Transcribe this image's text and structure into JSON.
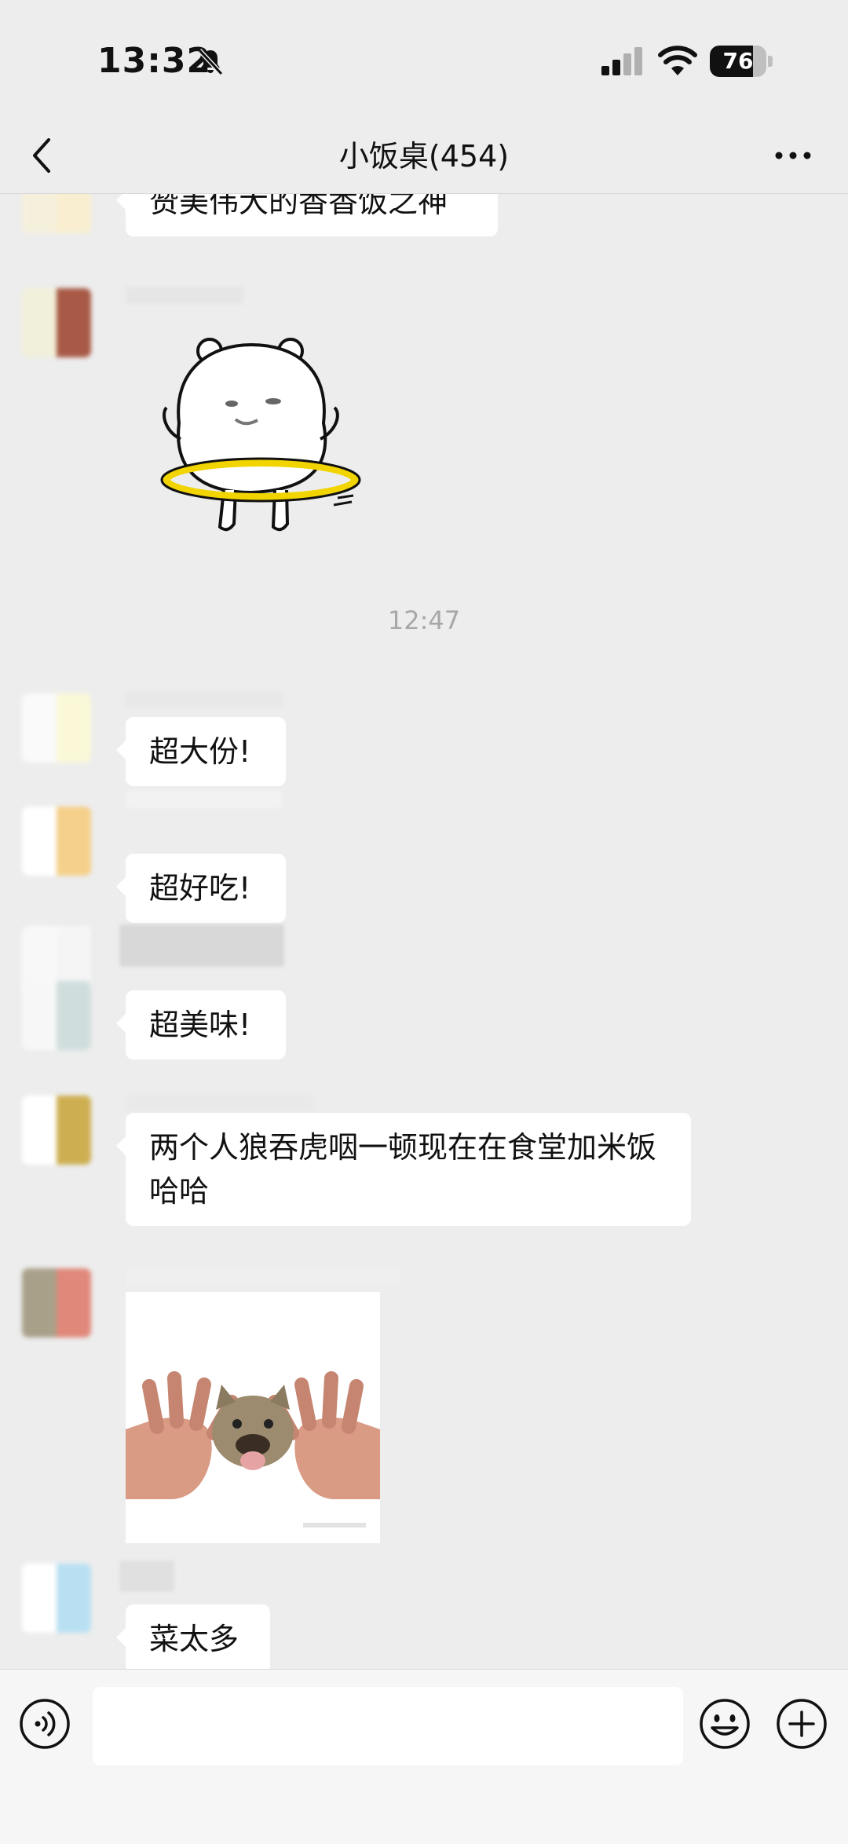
{
  "status_bar": {
    "time": "13:32",
    "battery": "76",
    "battery_level": 0.76
  },
  "nav": {
    "title": "小饭桌(454)"
  },
  "messages": [
    {
      "type": "text",
      "text": "赞美伟大的香香饭之神"
    },
    {
      "type": "sticker",
      "sticker": "bear-hula-hoop"
    },
    {
      "type": "timestamp",
      "text": "12:47"
    },
    {
      "type": "text",
      "text": "超大份!"
    },
    {
      "type": "text",
      "text": "超好吃!"
    },
    {
      "type": "text",
      "text": "超美味!"
    },
    {
      "type": "text",
      "text": "两个人狼吞虎咽一顿现在在食堂加米饭哈哈"
    },
    {
      "type": "sticker",
      "sticker": "cat-reaching-hands"
    },
    {
      "type": "text",
      "text": "菜太多"
    }
  ],
  "input_bar": {
    "placeholder": ""
  },
  "icons": {
    "back": "chevron-left-icon",
    "more": "ellipsis-icon",
    "voice": "voice-icon",
    "emoji": "smiley-icon",
    "plus": "plus-circle-icon",
    "mute": "bell-slash-icon",
    "signal": "cellular-signal-icon",
    "wifi": "wifi-icon"
  },
  "colors": {
    "background": "#EDEDED",
    "bubble": "#FFFFFF",
    "input_bar": "#F6F6F6",
    "timestamp": "#A8A8A8"
  }
}
